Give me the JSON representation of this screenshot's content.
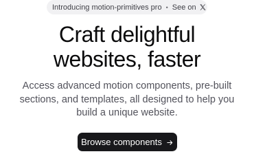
{
  "announcement": {
    "text": "Introducing motion-primitives pro",
    "separator": "•",
    "link_text": "See on",
    "link_icon": "x-logo-icon"
  },
  "hero": {
    "title_line1": "Craft delightful",
    "title_line2": "websites, faster",
    "description": "Access advanced motion components, pre-built sections, and templates, all designed to help you build a unique website."
  },
  "cta": {
    "label": "Browse components",
    "icon": "arrow-right-icon"
  },
  "colors": {
    "background": "#ffffff",
    "pill_background": "#f1f1f3",
    "button_background": "#18181b",
    "button_text": "#ffffff",
    "body_text": "#52525b"
  }
}
